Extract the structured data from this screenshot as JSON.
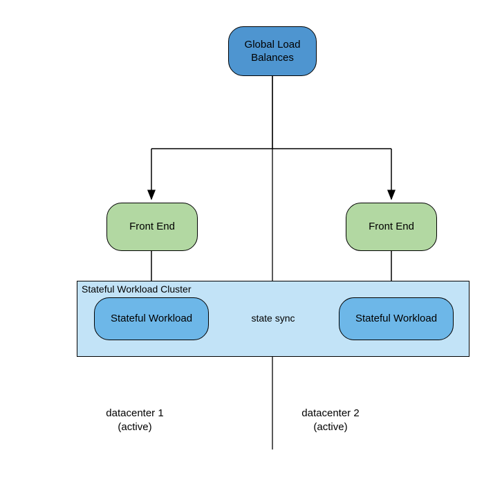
{
  "nodes": {
    "global_lb": "Global Load\nBalances",
    "front_end_1": "Front End",
    "front_end_2": "Front End",
    "stateful_1": "Stateful Workload",
    "stateful_2": "Stateful Workload"
  },
  "cluster": {
    "label": "Stateful Workload Cluster"
  },
  "arrows": {
    "sync_label": "state sync"
  },
  "datacenters": {
    "dc1": "datacenter 1\n(active)",
    "dc2": "datacenter 2\n(active)"
  },
  "colors": {
    "blue_node": "#4e95d0",
    "green_node": "#b2d8a2",
    "lightblue_node": "#6db7e8",
    "cluster_bg": "#c2e3f7",
    "arrow_orange": "#f2a922"
  }
}
